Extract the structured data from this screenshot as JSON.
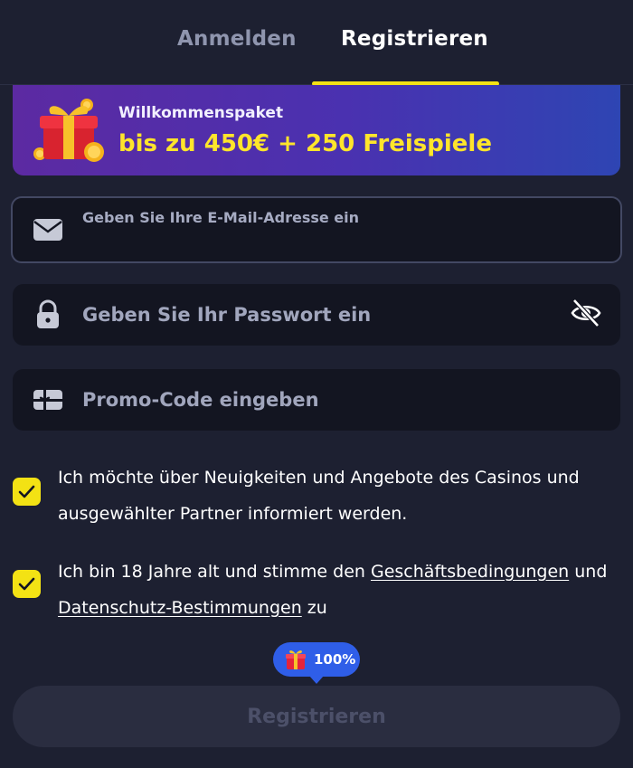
{
  "tabs": {
    "login_label": "Anmelden",
    "register_label": "Registrieren",
    "active": "register"
  },
  "banner": {
    "kicker": "Willkommenspaket",
    "headline": "bis zu 450€ + 250 Freispiele"
  },
  "form": {
    "email": {
      "label": "Geben Sie Ihre E-Mail-Adresse ein",
      "value": "",
      "icon": "envelope-icon"
    },
    "password": {
      "placeholder": "Geben Sie Ihr Passwort ein",
      "value": "",
      "icon": "lock-icon",
      "toggle_icon": "eye-slash-icon"
    },
    "promo": {
      "placeholder": "Promo-Code eingeben",
      "value": "",
      "icon": "gift-card-icon"
    }
  },
  "consents": {
    "newsletter": {
      "checked": true,
      "text": "Ich möchte über Neuigkeiten und Angebote des Casinos und ausgewählter Partner informiert werden."
    },
    "terms": {
      "checked": true,
      "text_before": "Ich bin 18 Jahre alt und stimme den ",
      "terms_link": "Geschäftsbedingungen",
      "text_middle": " und ",
      "privacy_link": "Datenschutz-Bestimmungen",
      "text_after": " zu"
    }
  },
  "progress": {
    "label": "100%",
    "value": 100,
    "icon": "gift-icon"
  },
  "submit": {
    "label": "Registrieren"
  },
  "colors": {
    "background": "#1d2031",
    "field_background": "#131521",
    "accent_yellow": "#f3e214",
    "headline_yellow": "#ffe52b",
    "badge_blue": "#2f5ee8",
    "banner_start": "#5c2aa2",
    "banner_end": "#2e45b3",
    "button_disabled": "#2a2d40"
  }
}
